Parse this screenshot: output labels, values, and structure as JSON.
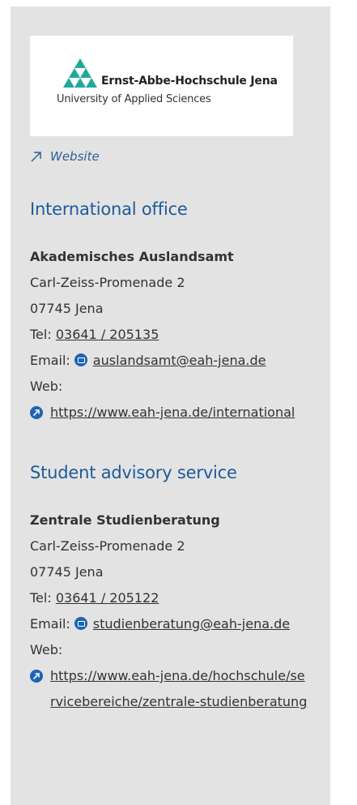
{
  "logo": {
    "name": "Ernst-Abbe-Hochschule Jena",
    "subtitle": "University of Applied Sciences",
    "brand_color": "#1fa99a"
  },
  "website_link": {
    "icon": "arrow-up-right-icon",
    "label": "Website"
  },
  "sections": [
    {
      "heading": "International office",
      "org": "Akademisches Auslandsamt",
      "street": "Carl-Zeiss-Promenade 2",
      "city": "07745 Jena",
      "tel_label": "Tel:",
      "tel": "03641 / 205135",
      "email_label": "Email:",
      "email": "auslandsamt@eah-jena.de",
      "web_label": "Web:",
      "web": "https://www.eah-jena.de/international"
    },
    {
      "heading": "Student advisory service",
      "org": "Zentrale Studienberatung",
      "street": "Carl-Zeiss-Promenade 2",
      "city": "07745 Jena",
      "tel_label": "Tel:",
      "tel": "03641 / 205122",
      "email_label": "Email:",
      "email": "studienberatung@eah-jena.de",
      "web_label": "Web:",
      "web": "https://www.eah-jena.de/hochschule/servicebereiche/zentrale-studienberatung"
    }
  ],
  "colors": {
    "panel_bg": "#e3e3e3",
    "heading": "#1d5b9a",
    "link_blue": "#2c5f97",
    "icon_blue": "#1e64b4"
  }
}
